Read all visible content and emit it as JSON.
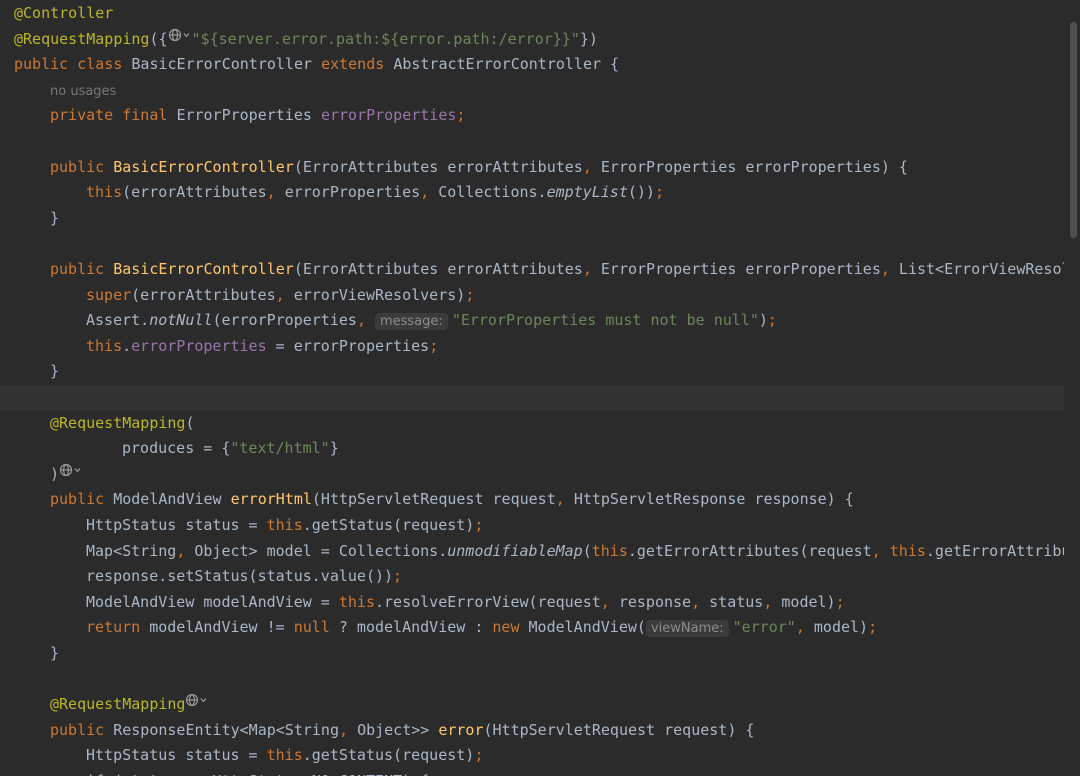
{
  "editor": {
    "language": "java",
    "colors": {
      "background": "#2b2b2b",
      "current_line": "#323232",
      "annotation": "#bbb529",
      "keyword": "#cc7832",
      "string": "#6a8759",
      "field": "#9876aa",
      "method_declaration": "#ffc66d",
      "plain": "#a9b7c6"
    },
    "lines": [
      {
        "tokens": [
          {
            "t": "@Controller",
            "c": "annotation"
          }
        ]
      },
      {
        "tokens": [
          {
            "t": "@RequestMapping",
            "c": "annotation"
          },
          {
            "t": "({",
            "c": "plain"
          },
          {
            "icon": "globe-icon"
          },
          {
            "t": "\"${server.error.path:${error.path:/error}}\"",
            "c": "string"
          },
          {
            "t": "})",
            "c": "plain"
          }
        ]
      },
      {
        "tokens": [
          {
            "t": "public class ",
            "c": "keyword"
          },
          {
            "t": "BasicErrorController ",
            "c": "plain"
          },
          {
            "t": "extends ",
            "c": "keyword"
          },
          {
            "t": "AbstractErrorController {",
            "c": "plain"
          }
        ]
      },
      {
        "indent": 1,
        "tokens": [
          {
            "t": "no usages",
            "c": "usage"
          }
        ]
      },
      {
        "indent": 1,
        "tokens": [
          {
            "t": "private final ",
            "c": "keyword"
          },
          {
            "t": "ErrorProperties ",
            "c": "plain"
          },
          {
            "t": "errorProperties",
            "c": "field"
          },
          {
            "t": ";",
            "c": "keyword"
          }
        ]
      },
      {
        "tokens": []
      },
      {
        "indent": 1,
        "tokens": [
          {
            "t": "public ",
            "c": "keyword"
          },
          {
            "t": "BasicErrorController",
            "c": "method-decl"
          },
          {
            "t": "(ErrorAttributes errorAttributes",
            "c": "plain"
          },
          {
            "t": ", ",
            "c": "keyword"
          },
          {
            "t": "ErrorProperties errorProperties) {",
            "c": "plain"
          }
        ]
      },
      {
        "indent": 2,
        "tokens": [
          {
            "t": "this",
            "c": "keyword"
          },
          {
            "t": "(errorAttributes",
            "c": "plain"
          },
          {
            "t": ", ",
            "c": "keyword"
          },
          {
            "t": "errorProperties",
            "c": "plain"
          },
          {
            "t": ", ",
            "c": "keyword"
          },
          {
            "t": "Collections.",
            "c": "plain"
          },
          {
            "t": "emptyList",
            "c": "static"
          },
          {
            "t": "())",
            "c": "plain"
          },
          {
            "t": ";",
            "c": "keyword"
          }
        ]
      },
      {
        "indent": 1,
        "tokens": [
          {
            "t": "}",
            "c": "plain"
          }
        ]
      },
      {
        "tokens": []
      },
      {
        "indent": 1,
        "tokens": [
          {
            "t": "public ",
            "c": "keyword"
          },
          {
            "t": "BasicErrorController",
            "c": "method-decl"
          },
          {
            "t": "(ErrorAttributes errorAttributes",
            "c": "plain"
          },
          {
            "t": ", ",
            "c": "keyword"
          },
          {
            "t": "ErrorProperties errorProperties",
            "c": "plain"
          },
          {
            "t": ", ",
            "c": "keyword"
          },
          {
            "t": "List<ErrorViewResolver> errorViewResolvers) {",
            "c": "plain"
          }
        ]
      },
      {
        "indent": 2,
        "tokens": [
          {
            "t": "super",
            "c": "keyword"
          },
          {
            "t": "(errorAttributes",
            "c": "plain"
          },
          {
            "t": ", ",
            "c": "keyword"
          },
          {
            "t": "errorViewResolvers)",
            "c": "plain"
          },
          {
            "t": ";",
            "c": "keyword"
          }
        ]
      },
      {
        "indent": 2,
        "tokens": [
          {
            "t": "Assert.",
            "c": "plain"
          },
          {
            "t": "notNull",
            "c": "static"
          },
          {
            "t": "(errorProperties",
            "c": "plain"
          },
          {
            "t": ", ",
            "c": "keyword"
          },
          {
            "t": "message:",
            "c": "hint"
          },
          {
            "t": "\"ErrorProperties must not be null\"",
            "c": "string"
          },
          {
            "t": ")",
            "c": "plain"
          },
          {
            "t": ";",
            "c": "keyword"
          }
        ]
      },
      {
        "indent": 2,
        "tokens": [
          {
            "t": "this",
            "c": "keyword"
          },
          {
            "t": ".",
            "c": "plain"
          },
          {
            "t": "errorProperties",
            "c": "field"
          },
          {
            "t": " = errorProperties",
            "c": "plain"
          },
          {
            "t": ";",
            "c": "keyword"
          }
        ]
      },
      {
        "indent": 1,
        "tokens": [
          {
            "t": "}",
            "c": "plain"
          }
        ]
      },
      {
        "current": true,
        "tokens": []
      },
      {
        "indent": 1,
        "tokens": [
          {
            "t": "@RequestMapping",
            "c": "annotation"
          },
          {
            "t": "(",
            "c": "plain"
          }
        ]
      },
      {
        "indent": 3,
        "tokens": [
          {
            "t": "produces = {",
            "c": "plain"
          },
          {
            "t": "\"text/html\"",
            "c": "string"
          },
          {
            "t": "}",
            "c": "plain"
          }
        ]
      },
      {
        "indent": 1,
        "tokens": [
          {
            "t": ")",
            "c": "plain"
          },
          {
            "icon": "globe-icon"
          }
        ]
      },
      {
        "indent": 1,
        "tokens": [
          {
            "t": "public ",
            "c": "keyword"
          },
          {
            "t": "ModelAndView ",
            "c": "plain"
          },
          {
            "t": "errorHtml",
            "c": "method-decl"
          },
          {
            "t": "(HttpServletRequest request",
            "c": "plain"
          },
          {
            "t": ", ",
            "c": "keyword"
          },
          {
            "t": "HttpServletResponse response) {",
            "c": "plain"
          }
        ]
      },
      {
        "indent": 2,
        "tokens": [
          {
            "t": "HttpStatus status = ",
            "c": "plain"
          },
          {
            "t": "this",
            "c": "keyword"
          },
          {
            "t": ".getStatus(request)",
            "c": "plain"
          },
          {
            "t": ";",
            "c": "keyword"
          }
        ]
      },
      {
        "indent": 2,
        "tokens": [
          {
            "t": "Map<String",
            "c": "plain"
          },
          {
            "t": ", ",
            "c": "keyword"
          },
          {
            "t": "Object> model = Collections.",
            "c": "plain"
          },
          {
            "t": "unmodifiableMap",
            "c": "static"
          },
          {
            "t": "(",
            "c": "plain"
          },
          {
            "t": "this",
            "c": "keyword"
          },
          {
            "t": ".getErrorAttributes(request",
            "c": "plain"
          },
          {
            "t": ", ",
            "c": "keyword"
          },
          {
            "t": "this",
            "c": "keyword"
          },
          {
            "t": ".getErrorAttributes",
            "c": "plain"
          }
        ]
      },
      {
        "indent": 2,
        "tokens": [
          {
            "t": "response.setStatus(status.value())",
            "c": "plain"
          },
          {
            "t": ";",
            "c": "keyword"
          }
        ]
      },
      {
        "indent": 2,
        "tokens": [
          {
            "t": "ModelAndView modelAndView = ",
            "c": "plain"
          },
          {
            "t": "this",
            "c": "keyword"
          },
          {
            "t": ".resolveErrorView(request",
            "c": "plain"
          },
          {
            "t": ", ",
            "c": "keyword"
          },
          {
            "t": "response",
            "c": "plain"
          },
          {
            "t": ", ",
            "c": "keyword"
          },
          {
            "t": "status",
            "c": "plain"
          },
          {
            "t": ", ",
            "c": "keyword"
          },
          {
            "t": "model)",
            "c": "plain"
          },
          {
            "t": ";",
            "c": "keyword"
          }
        ]
      },
      {
        "indent": 2,
        "tokens": [
          {
            "t": "return ",
            "c": "keyword"
          },
          {
            "t": "modelAndView != ",
            "c": "plain"
          },
          {
            "t": "null ",
            "c": "keyword"
          },
          {
            "t": "? modelAndView : ",
            "c": "plain"
          },
          {
            "t": "new ",
            "c": "keyword"
          },
          {
            "t": "ModelAndView(",
            "c": "plain"
          },
          {
            "t": "viewName:",
            "c": "hint"
          },
          {
            "t": "\"error\"",
            "c": "string"
          },
          {
            "t": ", ",
            "c": "keyword"
          },
          {
            "t": "model)",
            "c": "plain"
          },
          {
            "t": ";",
            "c": "keyword"
          }
        ]
      },
      {
        "indent": 1,
        "tokens": [
          {
            "t": "}",
            "c": "plain"
          }
        ]
      },
      {
        "tokens": []
      },
      {
        "indent": 1,
        "tokens": [
          {
            "t": "@RequestMapping",
            "c": "annotation"
          },
          {
            "icon": "globe-icon"
          }
        ]
      },
      {
        "indent": 1,
        "tokens": [
          {
            "t": "public ",
            "c": "keyword"
          },
          {
            "t": "ResponseEntity<Map<String",
            "c": "plain"
          },
          {
            "t": ", ",
            "c": "keyword"
          },
          {
            "t": "Object>> ",
            "c": "plain"
          },
          {
            "t": "error",
            "c": "method-decl"
          },
          {
            "t": "(HttpServletRequest request) {",
            "c": "plain"
          }
        ]
      },
      {
        "indent": 2,
        "tokens": [
          {
            "t": "HttpStatus status = ",
            "c": "plain"
          },
          {
            "t": "this",
            "c": "keyword"
          },
          {
            "t": ".getStatus(request)",
            "c": "plain"
          },
          {
            "t": ";",
            "c": "keyword"
          }
        ]
      },
      {
        "indent": 2,
        "tokens": [
          {
            "t": "if (status == HttpStatus.NO_CONTENT) {",
            "c": "plain"
          }
        ]
      }
    ]
  }
}
